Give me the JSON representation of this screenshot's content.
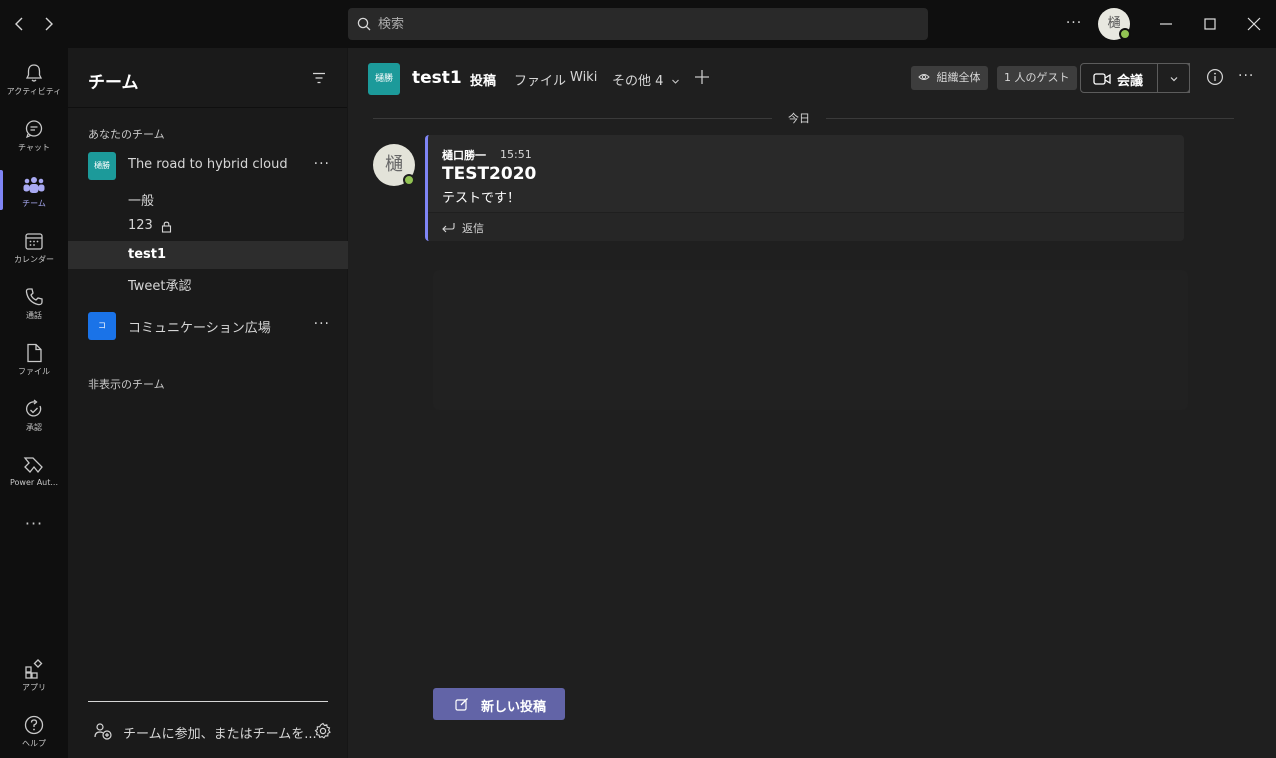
{
  "titlebar": {
    "search_placeholder": "検索",
    "avatar_initial": "樋"
  },
  "rail": {
    "items": [
      {
        "label": "アクティビティ",
        "icon": "bell-icon"
      },
      {
        "label": "チャット",
        "icon": "chat-icon"
      },
      {
        "label": "チーム",
        "icon": "teams-icon",
        "active": true
      },
      {
        "label": "カレンダー",
        "icon": "calendar-icon"
      },
      {
        "label": "通話",
        "icon": "phone-icon"
      },
      {
        "label": "ファイル",
        "icon": "file-icon"
      },
      {
        "label": "承認",
        "icon": "approvals-icon"
      },
      {
        "label": "Power Aut...",
        "icon": "power-automate-icon"
      },
      {
        "label": "アプリ",
        "icon": "apps-icon"
      },
      {
        "label": "ヘルプ",
        "icon": "help-icon"
      }
    ]
  },
  "teampane": {
    "title": "チーム",
    "your_teams_label": "あなたのチーム",
    "hidden_teams_label": "非表示のチーム",
    "join_label": "チームに参加、またはチームを...",
    "teams": [
      {
        "name": "The road to hybrid cloud",
        "tile_text": "樋勝",
        "tile_color": "#1c9a9a",
        "channels": [
          "一般",
          "123",
          "test1",
          "Tweet承認"
        ]
      },
      {
        "name": "コミュニケーション広場",
        "tile_text": "コ",
        "tile_color": "#1a73e8"
      }
    ],
    "active_channel": "test1"
  },
  "channel": {
    "tile_text": "樋勝",
    "name": "test1",
    "tabs": [
      "投稿",
      "ファイル",
      "Wiki",
      "その他 4"
    ],
    "org_chip": "組織全体",
    "guest_chip": "1 人のゲスト",
    "meet_label": "会議"
  },
  "feed": {
    "day_label": "今日",
    "message": {
      "avatar_initial": "樋",
      "author": "樋口勝一",
      "time": "15:51",
      "subject": "TEST2020",
      "body": "テストです！",
      "reply_label": "返信"
    }
  },
  "new_post_label": "新しい投稿",
  "colors": {
    "accent": "#7f85f5",
    "new_post_bg": "#6264a7",
    "presence": "#92c353"
  }
}
